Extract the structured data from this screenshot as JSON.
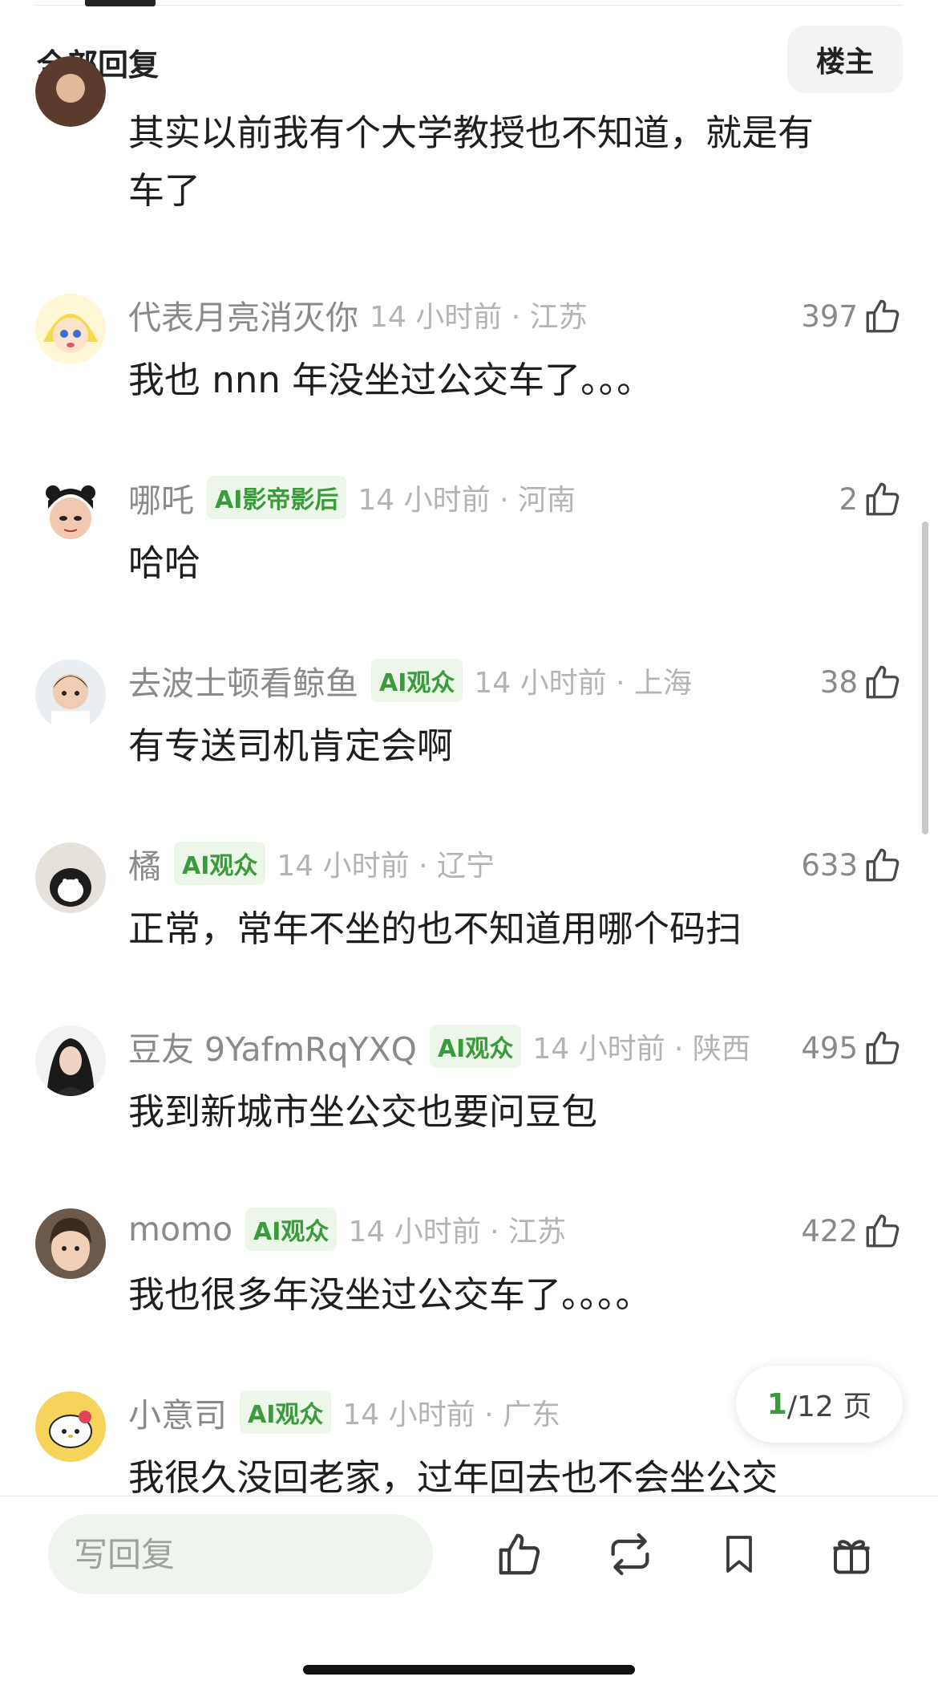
{
  "header": {
    "title": "全部回复",
    "owner_button": "楼主"
  },
  "first_comment": {
    "text": [
      "其实以前我有个大学教授也不知道，就是有",
      "车了"
    ]
  },
  "comments": [
    {
      "user": "代表月亮消灭你",
      "badge": "",
      "time": "14 小时前 · 江苏",
      "likes": "397",
      "text": "我也 nnn 年没坐过公交车了。。。",
      "avatar": "sailor-moon-avatar"
    },
    {
      "user": "哪吒",
      "badge": "AI影帝影后",
      "time": "14 小时前 · 河南",
      "likes": "2",
      "text": "哈哈",
      "avatar": "nezha-avatar"
    },
    {
      "user": "去波士顿看鲸鱼",
      "badge": "AI观众",
      "time": "14 小时前 · 上海",
      "likes": "38",
      "text": "有专送司机肯定会啊",
      "avatar": "child-photo-avatar"
    },
    {
      "user": "橘",
      "badge": "AI观众",
      "time": "14 小时前 · 辽宁",
      "likes": "633",
      "text": "正常，常年不坐的也不知道用哪个码扫",
      "avatar": "penguin-avatar"
    },
    {
      "user": "豆友 9YafmRqYXQ",
      "badge": "AI观众",
      "time": "14 小时前 · 陕西",
      "likes": "495",
      "text": "我到新城市坐公交也要问豆包",
      "avatar": "woman-portrait-avatar"
    },
    {
      "user": "momo",
      "badge": "AI观众",
      "time": "14 小时前 · 江苏",
      "likes": "422",
      "text": "我也很多年没坐过公交车了。。。。",
      "avatar": "girl-photo-avatar"
    },
    {
      "user": "小意司",
      "badge": "AI观众",
      "time": "14 小时前 · 广东",
      "likes": "",
      "text": "我很久没回老家，过年回去也不会坐公交",
      "avatar": "hello-kitty-avatar"
    }
  ],
  "pager": {
    "current": "1",
    "total": "/12 页"
  },
  "bottom_bar": {
    "reply_placeholder": "写回复",
    "icons": [
      "thumbs-up-icon",
      "repost-icon",
      "bookmark-icon",
      "gift-icon"
    ]
  },
  "colors": {
    "accent_green": "#3a9b3a",
    "badge_bg": "#ecf7ea",
    "muted": "#8a8a8a"
  }
}
